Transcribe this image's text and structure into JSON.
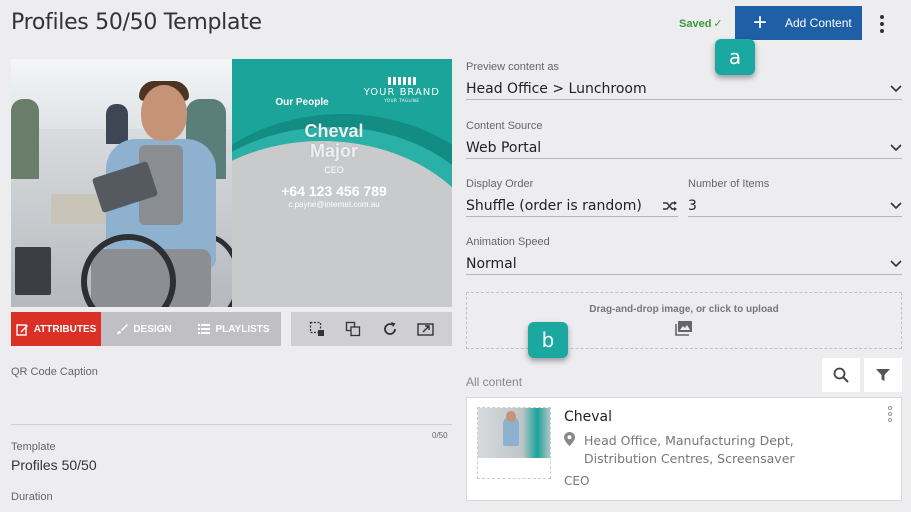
{
  "header": {
    "title": "Profiles 50/50 Template",
    "saved_label": "Saved",
    "saved_check": "✓",
    "add_button_label": "Add Content"
  },
  "callouts": {
    "a": "a",
    "b": "b"
  },
  "preview": {
    "brand": "YOUR BRAND",
    "brand_tagline": "YOUR TAGLINE",
    "section_title": "Our People",
    "first_name": "Cheval",
    "last_name": "Major",
    "role": "CEO",
    "phone": "+64 123 456 789",
    "email": "c.payne@internet.com.au"
  },
  "tabs": {
    "attributes": "ATTRIBUTES",
    "design": "DESIGN",
    "playlists": "PLAYLISTS",
    "active": "attributes"
  },
  "left_fields": {
    "qr_caption_label": "QR Code Caption",
    "qr_caption_count": "0/50",
    "template_label": "Template",
    "template_value": "Profiles 50/50",
    "duration_label": "Duration"
  },
  "settings": {
    "preview_as": {
      "label": "Preview content as",
      "value": "Head Office > Lunchroom"
    },
    "content_source": {
      "label": "Content Source",
      "value": "Web Portal"
    },
    "display_order": {
      "label": "Display Order",
      "value": "Shuffle (order is random)"
    },
    "number_of_items": {
      "label": "Number of Items",
      "value": "3"
    },
    "animation_speed": {
      "label": "Animation Speed",
      "value": "Normal"
    }
  },
  "upload": {
    "text": "Drag-and-drop image, or click to upload"
  },
  "content_list": {
    "label": "All content",
    "items": [
      {
        "title": "Cheval",
        "location": "Head Office, Manufacturing Dept, Distribution Centres, Screensaver",
        "role": "CEO"
      }
    ]
  },
  "colors": {
    "primary_button": "#1f5fa6",
    "active_tab": "#db3026",
    "callout": "#1aa8a0",
    "brand_teal": "#1aa49a",
    "saved_green": "#3a9a3a"
  }
}
